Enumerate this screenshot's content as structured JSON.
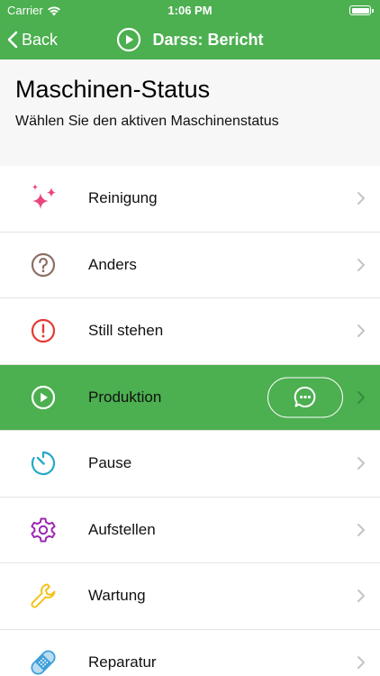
{
  "status_bar": {
    "carrier": "Carrier",
    "time": "1:06 PM"
  },
  "nav": {
    "back_label": "Back",
    "title": "Darss: Bericht",
    "title_icon": "play-circle-icon"
  },
  "header": {
    "title": "Maschinen-Status",
    "subtitle": "Wählen Sie den aktiven Maschinenstatus"
  },
  "colors": {
    "accent": "#4caf50"
  },
  "items": [
    {
      "label": "Reinigung",
      "icon": "sparkles-icon",
      "color": "#e8467c",
      "active": false
    },
    {
      "label": "Anders",
      "icon": "question-circle-icon",
      "color": "#8d6e63",
      "active": false
    },
    {
      "label": "Still stehen",
      "icon": "alert-circle-icon",
      "color": "#e53935",
      "active": false
    },
    {
      "label": "Produktion",
      "icon": "play-circle-icon",
      "color": "#ffffff",
      "active": true
    },
    {
      "label": "Pause",
      "icon": "timer-icon",
      "color": "#26a9c9",
      "active": false
    },
    {
      "label": "Aufstellen",
      "icon": "gear-icon",
      "color": "#9c27b0",
      "active": false
    },
    {
      "label": "Wartung",
      "icon": "wrench-icon",
      "color": "#f4c21b",
      "active": false
    },
    {
      "label": "Reparatur",
      "icon": "bandage-icon",
      "color": "#3fa0d8",
      "active": false
    }
  ]
}
